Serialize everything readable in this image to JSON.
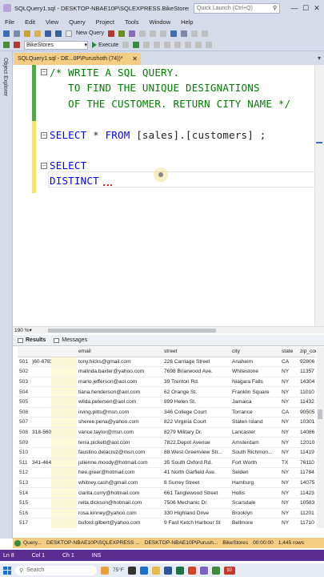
{
  "window": {
    "title": "SQLQuery1.sql - DESKTOP-NBAE10P\\SQLEXPRESS.BikeStores (DESKTO...",
    "quick_launch_placeholder": "Quick Launch (Ctrl+Q)",
    "minimize": "—",
    "maximize": "☐",
    "close": "✕"
  },
  "menu": [
    "File",
    "Edit",
    "View",
    "Query",
    "Project",
    "Tools",
    "Window",
    "Help"
  ],
  "toolbar": {
    "new_query": "New Query",
    "database": "BikeStores",
    "execute": "Execute"
  },
  "sidebar": {
    "label": "Object Explorer"
  },
  "doc_tab": {
    "label": "SQLQuery1.sql - DE...0P\\Purushoth (74))*",
    "pin": "⊹",
    "close": "✕"
  },
  "editor": {
    "lines": [
      "/* WRITE A SQL QUERY.",
      "   TO FIND THE UNIQUE DESIGNATIONS",
      "   OF THE CUSTOMER. RETURN CITY NAME */",
      "",
      "SELECT * FROM [sales].[customers] ;",
      "",
      "SELECT",
      "DISTINCT"
    ],
    "line4_keyword_select": "SELECT",
    "line4_star": "*",
    "line4_from": "FROM",
    "line4_rest": "[sales].[customers] ;",
    "select_kw": "SELECT",
    "distinct_kw": "DISTINCT"
  },
  "zoom": "190 %",
  "results_tabs": {
    "results": "Results",
    "messages": "Messages"
  },
  "grid": {
    "headers": [
      "",
      "",
      "email",
      "street",
      "city",
      "state",
      "zip_code"
    ],
    "rows": [
      [
        "501",
        ")60-6783",
        "tony.hicks@gmail.com",
        "226 Carriage Street",
        "Anaheim",
        "CA",
        "92806"
      ],
      [
        "502",
        "",
        "malinda.baxter@yahoo.com",
        "7698 Briarwood Ave.",
        "Whitestone",
        "NY",
        "11357"
      ],
      [
        "503",
        "",
        "marlo.jefferson@aol.com",
        "39 Trenton Rd.",
        "Niagara Falls",
        "NY",
        "14304"
      ],
      [
        "504",
        "",
        "tiana.henderson@aol.com",
        "62 Orange St.",
        "Franklin Square",
        "NY",
        "11010"
      ],
      [
        "505",
        "",
        "wilda.petersen@aol.com",
        "899 Helen St.",
        "Jamaica",
        "NY",
        "11432"
      ],
      [
        "506",
        "",
        "irving.pitts@msn.com",
        "346 College Court",
        "Torrance",
        "CA",
        "90505"
      ],
      [
        "507",
        "",
        "sheree.pena@yahoo.com",
        "822 Virginia Court",
        "Staten Island",
        "NY",
        "10301"
      ],
      [
        "508",
        "318-5607",
        "vance.taylor@msn.com",
        "8279 Military Dr.",
        "Lancaster",
        "NY",
        "14086"
      ],
      [
        "509",
        "",
        "terra.pickett@aol.com",
        "7822.Depot Avenue",
        "Amsterdam",
        "NY",
        "12010"
      ],
      [
        "510",
        "",
        "faustino.delacruz@msn.com",
        "88 West Greenview Str...",
        "South Richmon...",
        "NY",
        "11419"
      ],
      [
        "511",
        "341-4643",
        "julienne.moody@hotmail.com",
        "35 South Oxford Rd.",
        "Fort Worth",
        "TX",
        "76110"
      ],
      [
        "512",
        "",
        "hee.greer@hotmail.com",
        "41 North Garfield Ave.",
        "Selden",
        "NY",
        "11784"
      ],
      [
        "513",
        "",
        "whitney.cash@gmail.com",
        "8 Surrey Street",
        "Hamburg",
        "NY",
        "14075"
      ],
      [
        "514",
        "",
        "clarita.curry@hotmail.com",
        "661 Tanglewood Street",
        "Hollis",
        "NY",
        "11423"
      ],
      [
        "515",
        "",
        "reita.dickson@hotmail.com",
        "7506 Mechanic Dr.",
        "Scarsdale",
        "NY",
        "10583"
      ],
      [
        "516",
        "",
        "rosa.kinney@yahoo.com",
        "330 Highland Drive",
        "Brooklyn",
        "NY",
        "11201"
      ],
      [
        "517",
        "",
        "buford.gilbert@yahoo.com",
        "9 Fast Ketch Harbour St",
        "Bellmore",
        "NY",
        "11710"
      ]
    ]
  },
  "query_status": {
    "status": "Query...",
    "server": "DESKTOP-NBAE10P\\SQLEXPRESS ...",
    "user": "DESKTOP-NBAE10P\\Purush...",
    "db": "BikeStores",
    "time": "00:00:00",
    "rows": "1,445 rows"
  },
  "statusbar": {
    "ln": "Ln 8",
    "col": "Col 1",
    "ch": "Ch 1",
    "ins": "INS"
  },
  "taskbar": {
    "search": "Search",
    "temp": "75°F",
    "badge": "92"
  },
  "colors": {
    "chrome": "#d6dbe9",
    "tab_active": "#f5cc84",
    "status_purple": "#5c2d91",
    "comment": "#008000",
    "keyword": "#0000ff"
  }
}
